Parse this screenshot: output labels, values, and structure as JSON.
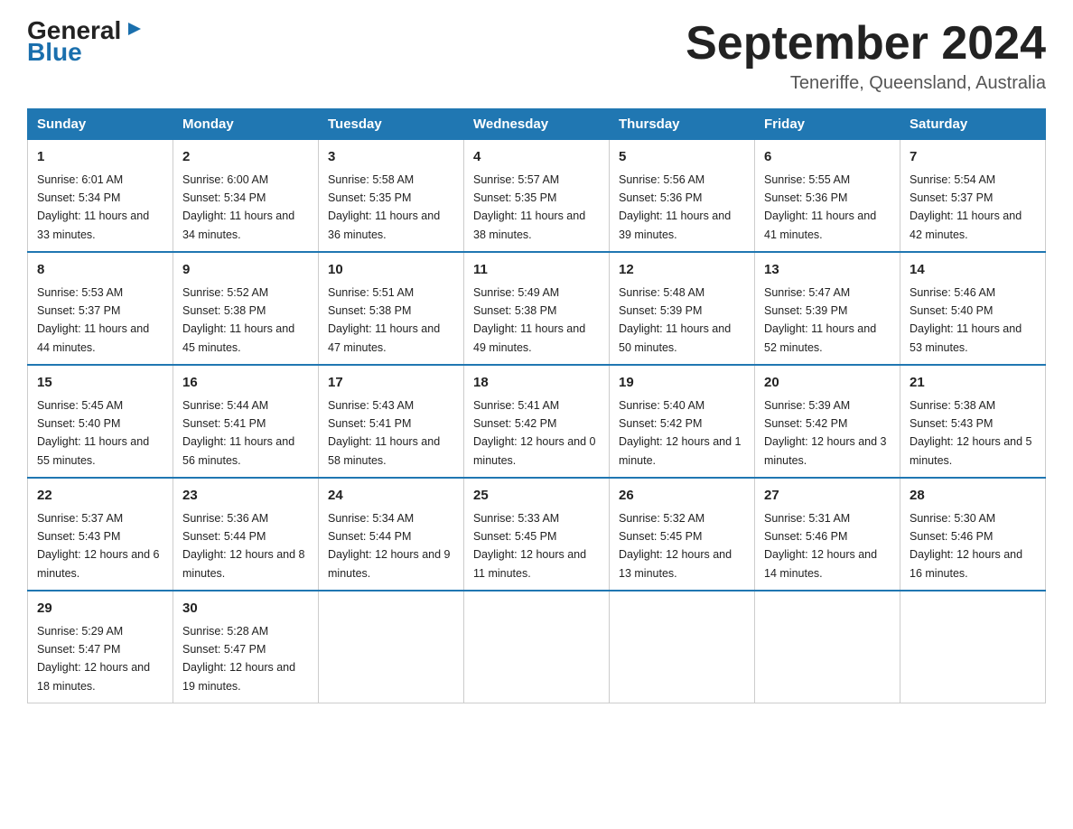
{
  "logo": {
    "line1": "General",
    "arrow": "▶",
    "line2": "Blue"
  },
  "header": {
    "title": "September 2024",
    "subtitle": "Teneriffe, Queensland, Australia"
  },
  "days_header": [
    "Sunday",
    "Monday",
    "Tuesday",
    "Wednesday",
    "Thursday",
    "Friday",
    "Saturday"
  ],
  "weeks": [
    [
      {
        "day": "1",
        "sunrise": "6:01 AM",
        "sunset": "5:34 PM",
        "daylight": "11 hours and 33 minutes."
      },
      {
        "day": "2",
        "sunrise": "6:00 AM",
        "sunset": "5:34 PM",
        "daylight": "11 hours and 34 minutes."
      },
      {
        "day": "3",
        "sunrise": "5:58 AM",
        "sunset": "5:35 PM",
        "daylight": "11 hours and 36 minutes."
      },
      {
        "day": "4",
        "sunrise": "5:57 AM",
        "sunset": "5:35 PM",
        "daylight": "11 hours and 38 minutes."
      },
      {
        "day": "5",
        "sunrise": "5:56 AM",
        "sunset": "5:36 PM",
        "daylight": "11 hours and 39 minutes."
      },
      {
        "day": "6",
        "sunrise": "5:55 AM",
        "sunset": "5:36 PM",
        "daylight": "11 hours and 41 minutes."
      },
      {
        "day": "7",
        "sunrise": "5:54 AM",
        "sunset": "5:37 PM",
        "daylight": "11 hours and 42 minutes."
      }
    ],
    [
      {
        "day": "8",
        "sunrise": "5:53 AM",
        "sunset": "5:37 PM",
        "daylight": "11 hours and 44 minutes."
      },
      {
        "day": "9",
        "sunrise": "5:52 AM",
        "sunset": "5:38 PM",
        "daylight": "11 hours and 45 minutes."
      },
      {
        "day": "10",
        "sunrise": "5:51 AM",
        "sunset": "5:38 PM",
        "daylight": "11 hours and 47 minutes."
      },
      {
        "day": "11",
        "sunrise": "5:49 AM",
        "sunset": "5:38 PM",
        "daylight": "11 hours and 49 minutes."
      },
      {
        "day": "12",
        "sunrise": "5:48 AM",
        "sunset": "5:39 PM",
        "daylight": "11 hours and 50 minutes."
      },
      {
        "day": "13",
        "sunrise": "5:47 AM",
        "sunset": "5:39 PM",
        "daylight": "11 hours and 52 minutes."
      },
      {
        "day": "14",
        "sunrise": "5:46 AM",
        "sunset": "5:40 PM",
        "daylight": "11 hours and 53 minutes."
      }
    ],
    [
      {
        "day": "15",
        "sunrise": "5:45 AM",
        "sunset": "5:40 PM",
        "daylight": "11 hours and 55 minutes."
      },
      {
        "day": "16",
        "sunrise": "5:44 AM",
        "sunset": "5:41 PM",
        "daylight": "11 hours and 56 minutes."
      },
      {
        "day": "17",
        "sunrise": "5:43 AM",
        "sunset": "5:41 PM",
        "daylight": "11 hours and 58 minutes."
      },
      {
        "day": "18",
        "sunrise": "5:41 AM",
        "sunset": "5:42 PM",
        "daylight": "12 hours and 0 minutes."
      },
      {
        "day": "19",
        "sunrise": "5:40 AM",
        "sunset": "5:42 PM",
        "daylight": "12 hours and 1 minute."
      },
      {
        "day": "20",
        "sunrise": "5:39 AM",
        "sunset": "5:42 PM",
        "daylight": "12 hours and 3 minutes."
      },
      {
        "day": "21",
        "sunrise": "5:38 AM",
        "sunset": "5:43 PM",
        "daylight": "12 hours and 5 minutes."
      }
    ],
    [
      {
        "day": "22",
        "sunrise": "5:37 AM",
        "sunset": "5:43 PM",
        "daylight": "12 hours and 6 minutes."
      },
      {
        "day": "23",
        "sunrise": "5:36 AM",
        "sunset": "5:44 PM",
        "daylight": "12 hours and 8 minutes."
      },
      {
        "day": "24",
        "sunrise": "5:34 AM",
        "sunset": "5:44 PM",
        "daylight": "12 hours and 9 minutes."
      },
      {
        "day": "25",
        "sunrise": "5:33 AM",
        "sunset": "5:45 PM",
        "daylight": "12 hours and 11 minutes."
      },
      {
        "day": "26",
        "sunrise": "5:32 AM",
        "sunset": "5:45 PM",
        "daylight": "12 hours and 13 minutes."
      },
      {
        "day": "27",
        "sunrise": "5:31 AM",
        "sunset": "5:46 PM",
        "daylight": "12 hours and 14 minutes."
      },
      {
        "day": "28",
        "sunrise": "5:30 AM",
        "sunset": "5:46 PM",
        "daylight": "12 hours and 16 minutes."
      }
    ],
    [
      {
        "day": "29",
        "sunrise": "5:29 AM",
        "sunset": "5:47 PM",
        "daylight": "12 hours and 18 minutes."
      },
      {
        "day": "30",
        "sunrise": "5:28 AM",
        "sunset": "5:47 PM",
        "daylight": "12 hours and 19 minutes."
      },
      {
        "day": "",
        "sunrise": "",
        "sunset": "",
        "daylight": ""
      },
      {
        "day": "",
        "sunrise": "",
        "sunset": "",
        "daylight": ""
      },
      {
        "day": "",
        "sunrise": "",
        "sunset": "",
        "daylight": ""
      },
      {
        "day": "",
        "sunrise": "",
        "sunset": "",
        "daylight": ""
      },
      {
        "day": "",
        "sunrise": "",
        "sunset": "",
        "daylight": ""
      }
    ]
  ],
  "labels": {
    "sunrise": "Sunrise: ",
    "sunset": "Sunset: ",
    "daylight": "Daylight: "
  }
}
